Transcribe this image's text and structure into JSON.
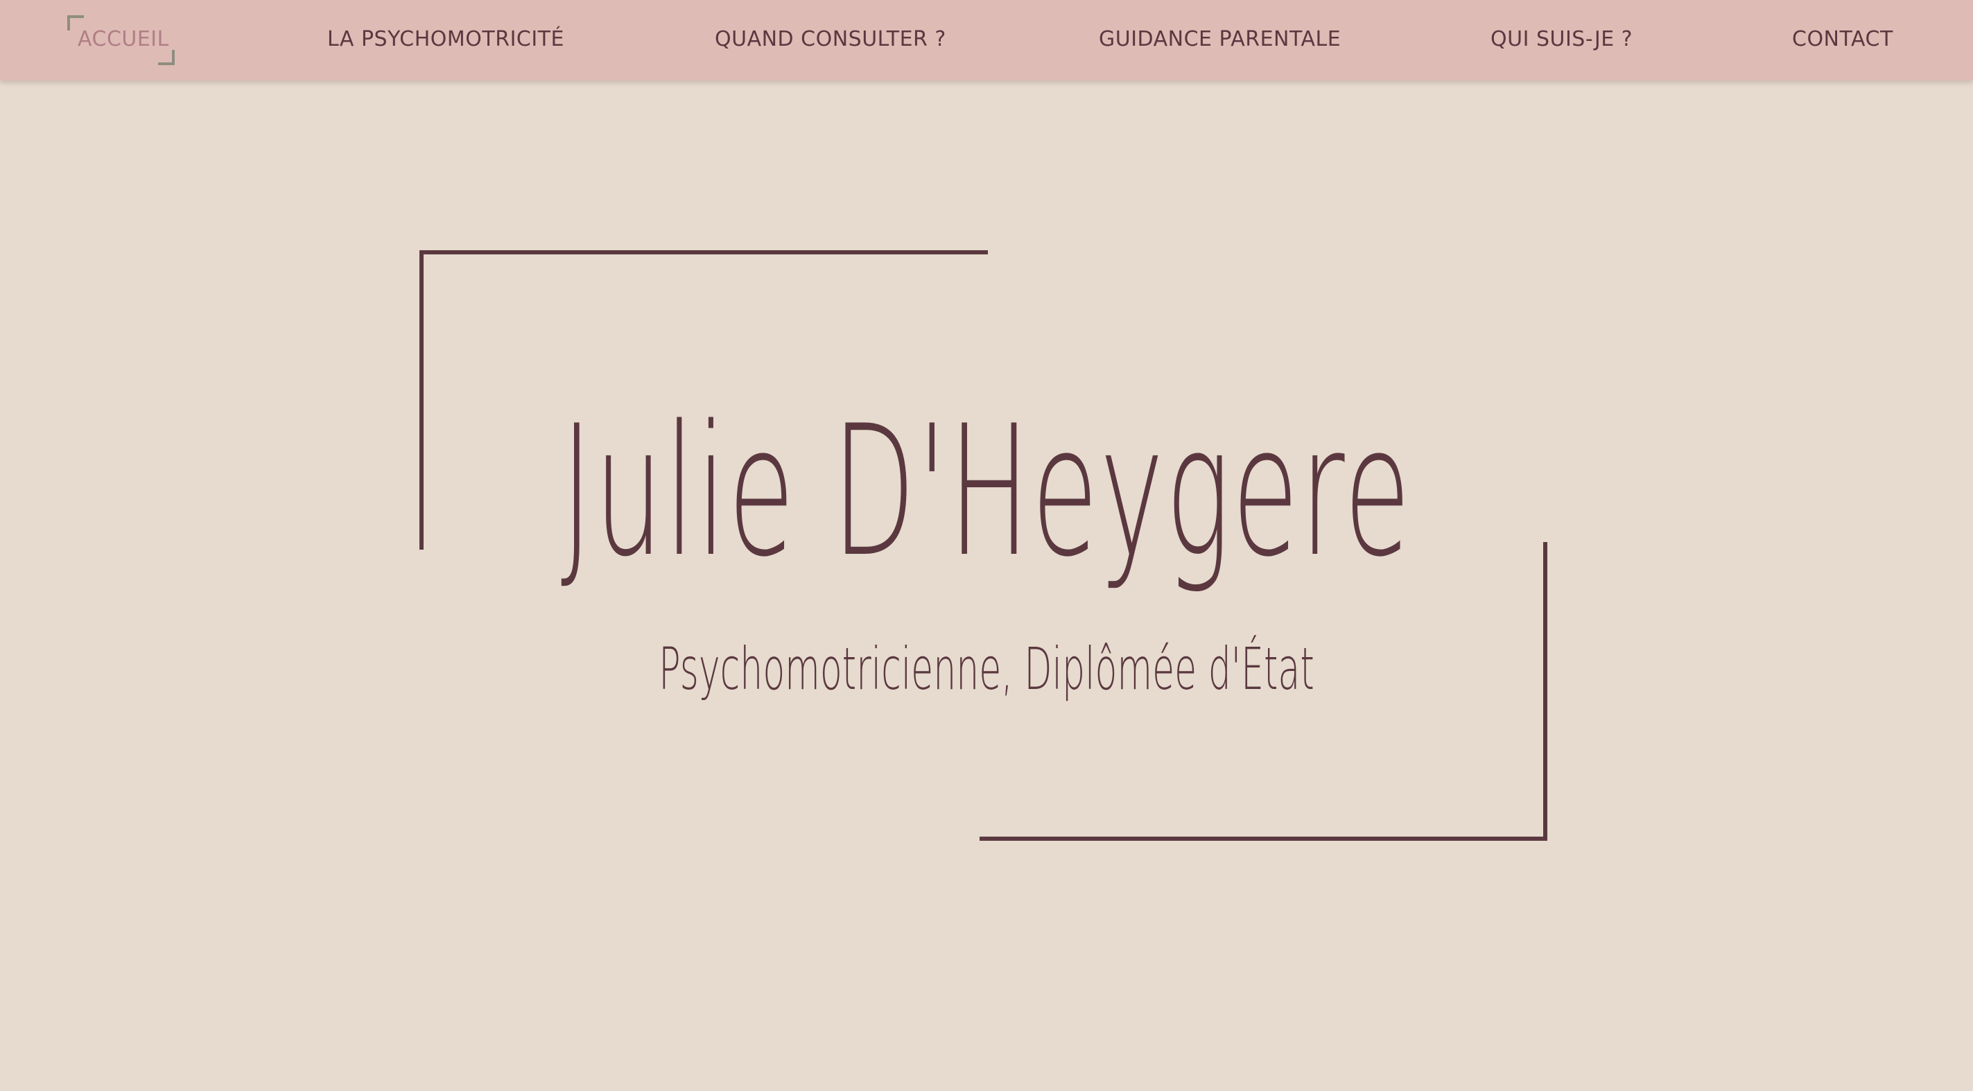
{
  "nav": {
    "items": [
      {
        "label": "ACCUEIL",
        "active": true
      },
      {
        "label": "LA PSYCHOMOTRICITÉ",
        "active": false
      },
      {
        "label": "QUAND CONSULTER ?",
        "active": false
      },
      {
        "label": "GUIDANCE PARENTALE",
        "active": false
      },
      {
        "label": "QUI SUIS-JE ?",
        "active": false
      },
      {
        "label": "CONTACT",
        "active": false
      }
    ]
  },
  "hero": {
    "title": "Julie D'Heygere",
    "subtitle": "Psychomotricienne, Diplômée d'État"
  },
  "colors": {
    "background": "#e6dbce",
    "navbar": "#dfbbb5",
    "text": "#5b3840",
    "active_nav": "#b07f86",
    "active_corner": "#8e8e80"
  }
}
